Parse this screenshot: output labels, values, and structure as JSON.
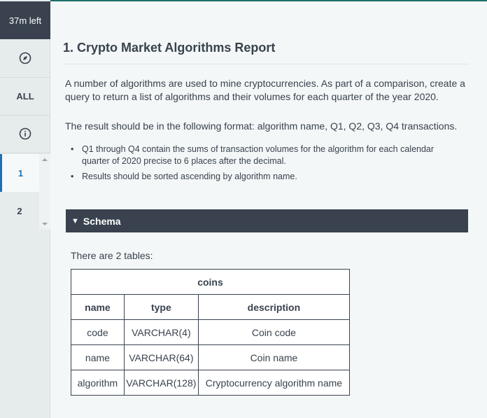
{
  "sidebar": {
    "timer": "37m left",
    "all_label": "ALL",
    "questions": [
      "1",
      "2"
    ]
  },
  "question": {
    "title": "1. Crypto Market Algorithms Report",
    "intro": "A number of algorithms are used to mine cryptocurrencies. As part of a comparison, create a query to return a list of algorithms and their volumes for each quarter of the year 2020.",
    "format": "The result should be in the following format: algorithm name, Q1, Q2, Q3, Q4 transactions.",
    "bullets": [
      "Q1 through Q4 contain the sums of transaction volumes for the algorithm for each calendar quarter of 2020 precise to 6 places after the decimal.",
      "Results should be sorted ascending by algorithm name."
    ]
  },
  "schema": {
    "label": "Schema",
    "tables_count_text": "There are 2 tables:",
    "coins_table": {
      "name": "coins",
      "headers": [
        "name",
        "type",
        "description"
      ],
      "rows": [
        [
          "code",
          "VARCHAR(4)",
          "Coin code"
        ],
        [
          "name",
          "VARCHAR(64)",
          "Coin name"
        ],
        [
          "algorithm",
          "VARCHAR(128)",
          "Cryptocurrency algorithm name"
        ]
      ]
    }
  },
  "colors": {
    "sidebar_dark": "#39424e",
    "active_blue": "#1f6fb2",
    "accent_line": "#1b6f6a"
  }
}
